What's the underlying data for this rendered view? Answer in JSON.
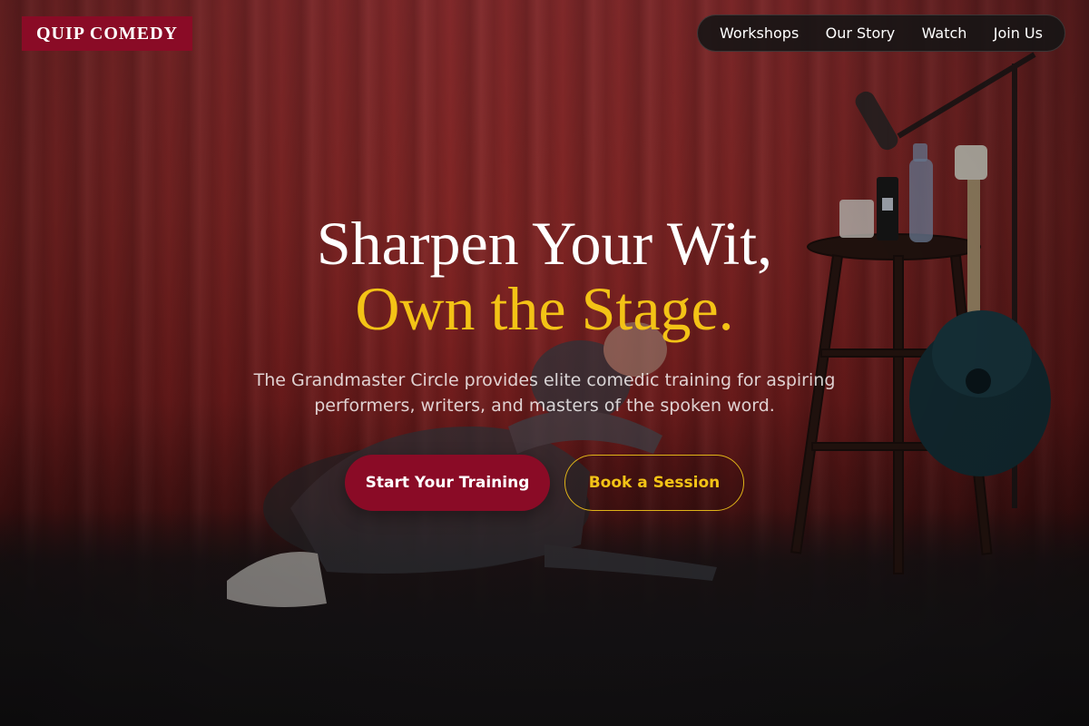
{
  "brand": {
    "logo_text": "QUIP COMEDY",
    "accent": "#8a0b26",
    "highlight": "#f3c316"
  },
  "nav": {
    "items": [
      {
        "label": "Workshops"
      },
      {
        "label": "Our Story"
      },
      {
        "label": "Watch"
      },
      {
        "label": "Join Us"
      }
    ]
  },
  "hero": {
    "headline_line1": "Sharpen Your Wit,",
    "headline_line2": "Own the Stage.",
    "subtitle": "The Grandmaster Circle provides elite comedic training for aspiring performers, writers, and masters of the spoken word.",
    "primary_cta": "Start Your Training",
    "secondary_cta": "Book a Session",
    "background_image": "comedian-on-stage-photo"
  }
}
